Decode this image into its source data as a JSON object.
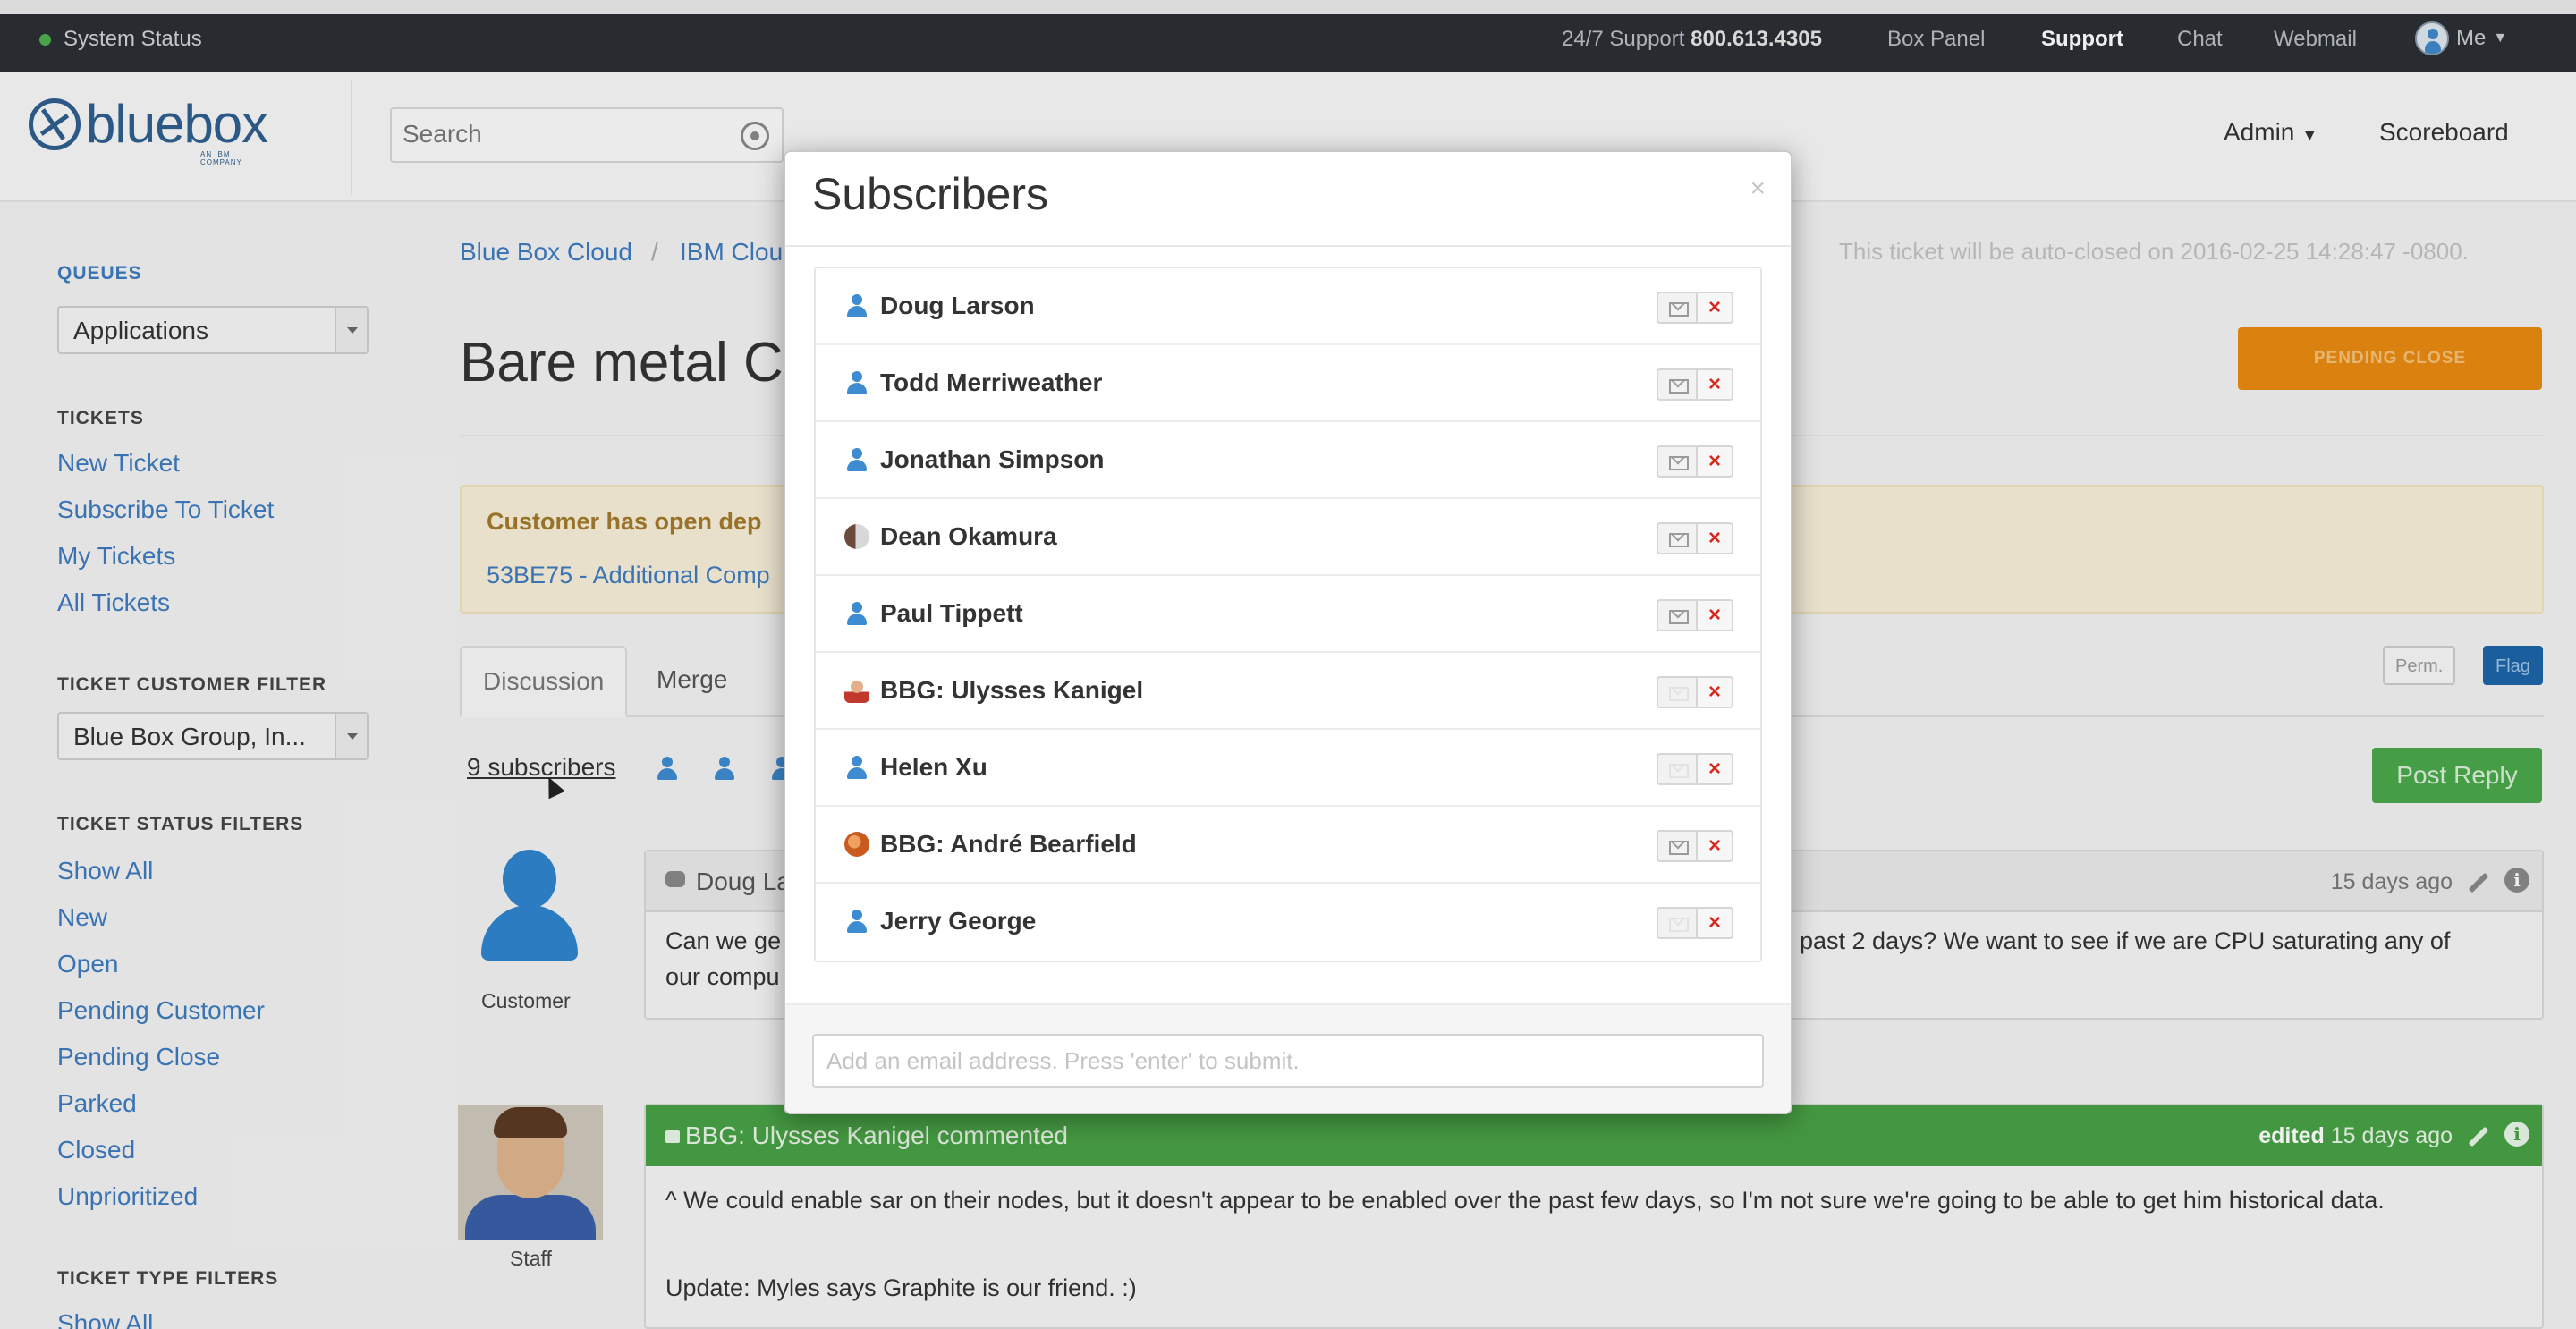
{
  "topbar": {
    "system_status": "System Status",
    "support_label": "24/7 Support",
    "support_phone": "800.613.4305",
    "links": [
      "Box Panel",
      "Support",
      "Chat",
      "Webmail"
    ],
    "active_link": "Support",
    "user": "Me"
  },
  "header": {
    "logo_text": "bluebox",
    "logo_sub": "AN IBM COMPANY",
    "search_placeholder": "Search",
    "admin": "Admin",
    "scoreboard": "Scoreboard"
  },
  "sidebar": {
    "queues_heading": "QUEUES",
    "queues_value": "Applications",
    "tickets_heading": "TICKETS",
    "tickets_links": [
      "New Ticket",
      "Subscribe To Ticket",
      "My Tickets",
      "All Tickets"
    ],
    "customer_filter_heading": "TICKET CUSTOMER FILTER",
    "customer_filter_value": "Blue Box Group, In...",
    "status_heading": "TICKET STATUS FILTERS",
    "status_links": [
      "Show All",
      "New",
      "Open",
      "Pending Customer",
      "Pending Close",
      "Parked",
      "Closed",
      "Unprioritized"
    ],
    "type_heading": "TICKET TYPE FILTERS",
    "type_first": "Show All"
  },
  "main": {
    "breadcrumb": [
      "Blue Box Cloud",
      "IBM Clou"
    ],
    "autoclose": "This ticket will be auto-closed on 2016-02-25 14:28:47 -0800.",
    "title": "Bare metal C",
    "pending_button": "PENDING CLOSE",
    "alert_line1": "Customer has open dep",
    "alert_line2": "53BE75 - Additional Comp",
    "tabs": [
      "Discussion",
      "Merge"
    ],
    "perm_button": "Perm.",
    "flag_button": "Flag",
    "subscribers_link": "9 subscribers",
    "post_reply": "Post Reply",
    "comment1": {
      "author": "Doug La",
      "time": "15 days ago",
      "body_left": "Can we ge",
      "body_left2": "our compu",
      "body_right": "past 2 days? We want to see if we are CPU saturating any of",
      "role": "Customer"
    },
    "comment2": {
      "author": "BBG: Ulysses Kanigel commented",
      "edited": "edited",
      "time": "15 days ago",
      "body1": "^ We could enable sar on their nodes, but it doesn't appear to be enabled over the past few days, so I'm not sure we're going to be able to get him historical data.",
      "body2": "Update: Myles says Graphite is our friend. :)",
      "role": "Staff"
    }
  },
  "modal": {
    "title": "Subscribers",
    "close": "×",
    "subscribers": [
      {
        "name": "Doug Larson",
        "avatar": "person-icon",
        "email_enabled": true
      },
      {
        "name": "Todd Merriweather",
        "avatar": "person-icon",
        "email_enabled": true
      },
      {
        "name": "Jonathan Simpson",
        "avatar": "person-icon",
        "email_enabled": true
      },
      {
        "name": "Dean Okamura",
        "avatar": "photo",
        "email_enabled": true
      },
      {
        "name": "Paul Tippett",
        "avatar": "person-icon",
        "email_enabled": true
      },
      {
        "name": "BBG: Ulysses Kanigel",
        "avatar": "photo",
        "email_enabled": false
      },
      {
        "name": "Helen Xu",
        "avatar": "person-icon",
        "email_enabled": false
      },
      {
        "name": "BBG: André Bearfield",
        "avatar": "photo",
        "email_enabled": true
      },
      {
        "name": "Jerry George",
        "avatar": "person-icon",
        "email_enabled": false
      }
    ],
    "remove_glyph": "×",
    "email_placeholder": "Add an email address. Press 'enter' to submit."
  },
  "colors": {
    "topbar": "#2b2f33",
    "link_blue": "#3d7bbf",
    "pending_orange": "#e88a10",
    "comment_green": "#49a146",
    "remove_red": "#d9271c"
  }
}
